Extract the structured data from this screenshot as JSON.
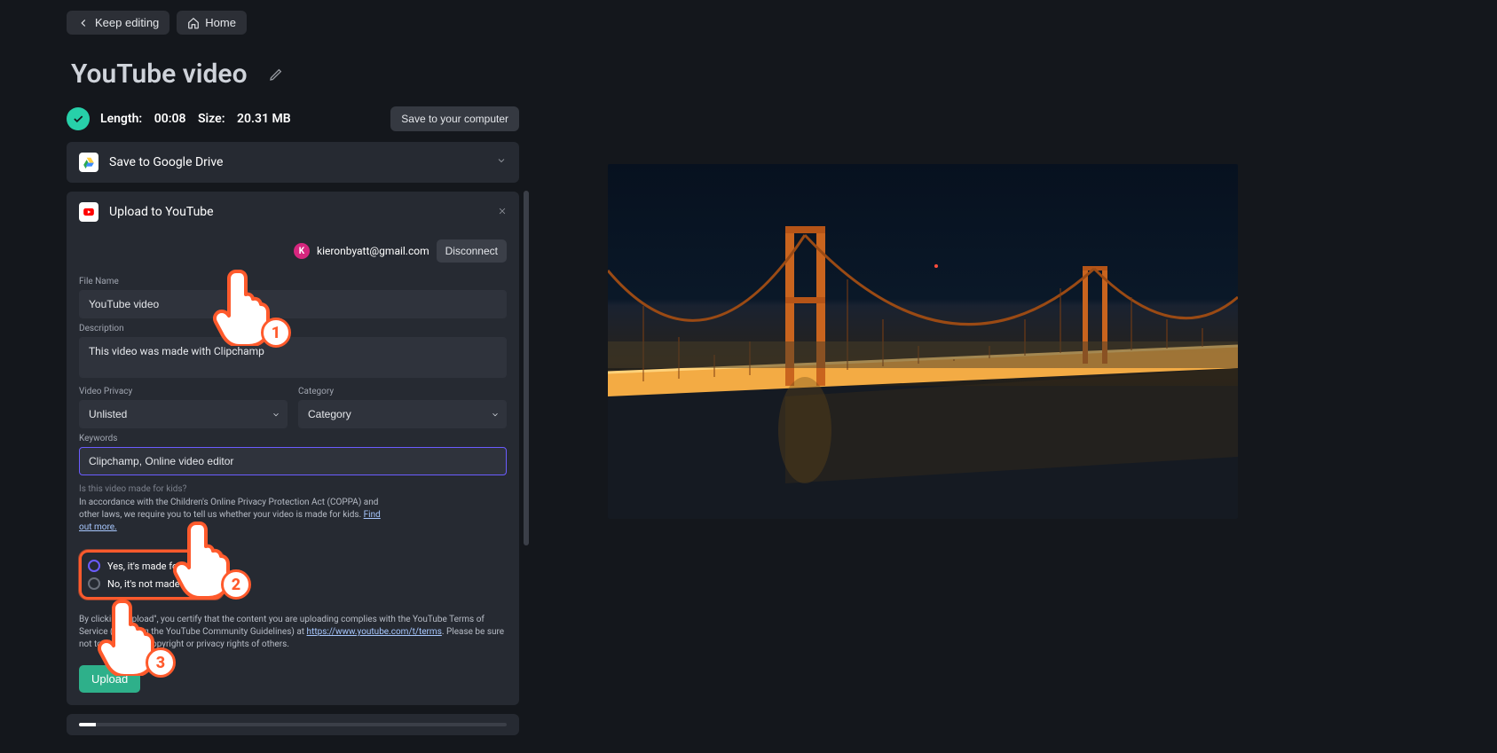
{
  "topbar": {
    "keep_editing": "Keep editing",
    "home": "Home"
  },
  "title": "YouTube video",
  "meta": {
    "length_label": "Length:",
    "length_value": "00:08",
    "size_label": "Size:",
    "size_value": "20.31 MB",
    "save_to_computer": "Save to your computer"
  },
  "gdrive": {
    "title": "Save to Google Drive"
  },
  "youtube": {
    "title": "Upload to YouTube",
    "account": {
      "initial": "K",
      "email": "kieronbyatt@gmail.com",
      "disconnect": "Disconnect"
    },
    "filename_label": "File Name",
    "filename_value": "YouTube video",
    "description_label": "Description",
    "description_value": "This video was made with Clipchamp",
    "privacy_label": "Video Privacy",
    "privacy_value": "Unlisted",
    "category_label": "Category",
    "category_value": "Category",
    "keywords_label": "Keywords",
    "keywords_value": "Clipchamp, Online video editor",
    "kids_question": "Is this video made for kids?",
    "kids_para": "In accordance with the Children's Online Privacy Protection Act (COPPA) and other laws, we require you to tell us whether your video is made for kids. ",
    "kids_find_out": "Find out more.",
    "radio_yes": "Yes, it's made for kids",
    "radio_no": "No, it's not made for kids",
    "legal_pre": "By clicking \"Upload\", you certify that the content you are uploading complies with the YouTube Terms of Service (including the YouTube Community Guidelines) at ",
    "legal_link": "https://www.youtube.com/t/terms",
    "legal_post": ". Please be sure not to violate the copyright or privacy rights of others.",
    "upload_button": "Upload"
  },
  "callouts": {
    "one": "1",
    "two": "2",
    "three": "3"
  },
  "colors": {
    "accent": "#6b5cff",
    "highlight": "#ff5a2c",
    "success": "#2eb08a"
  }
}
